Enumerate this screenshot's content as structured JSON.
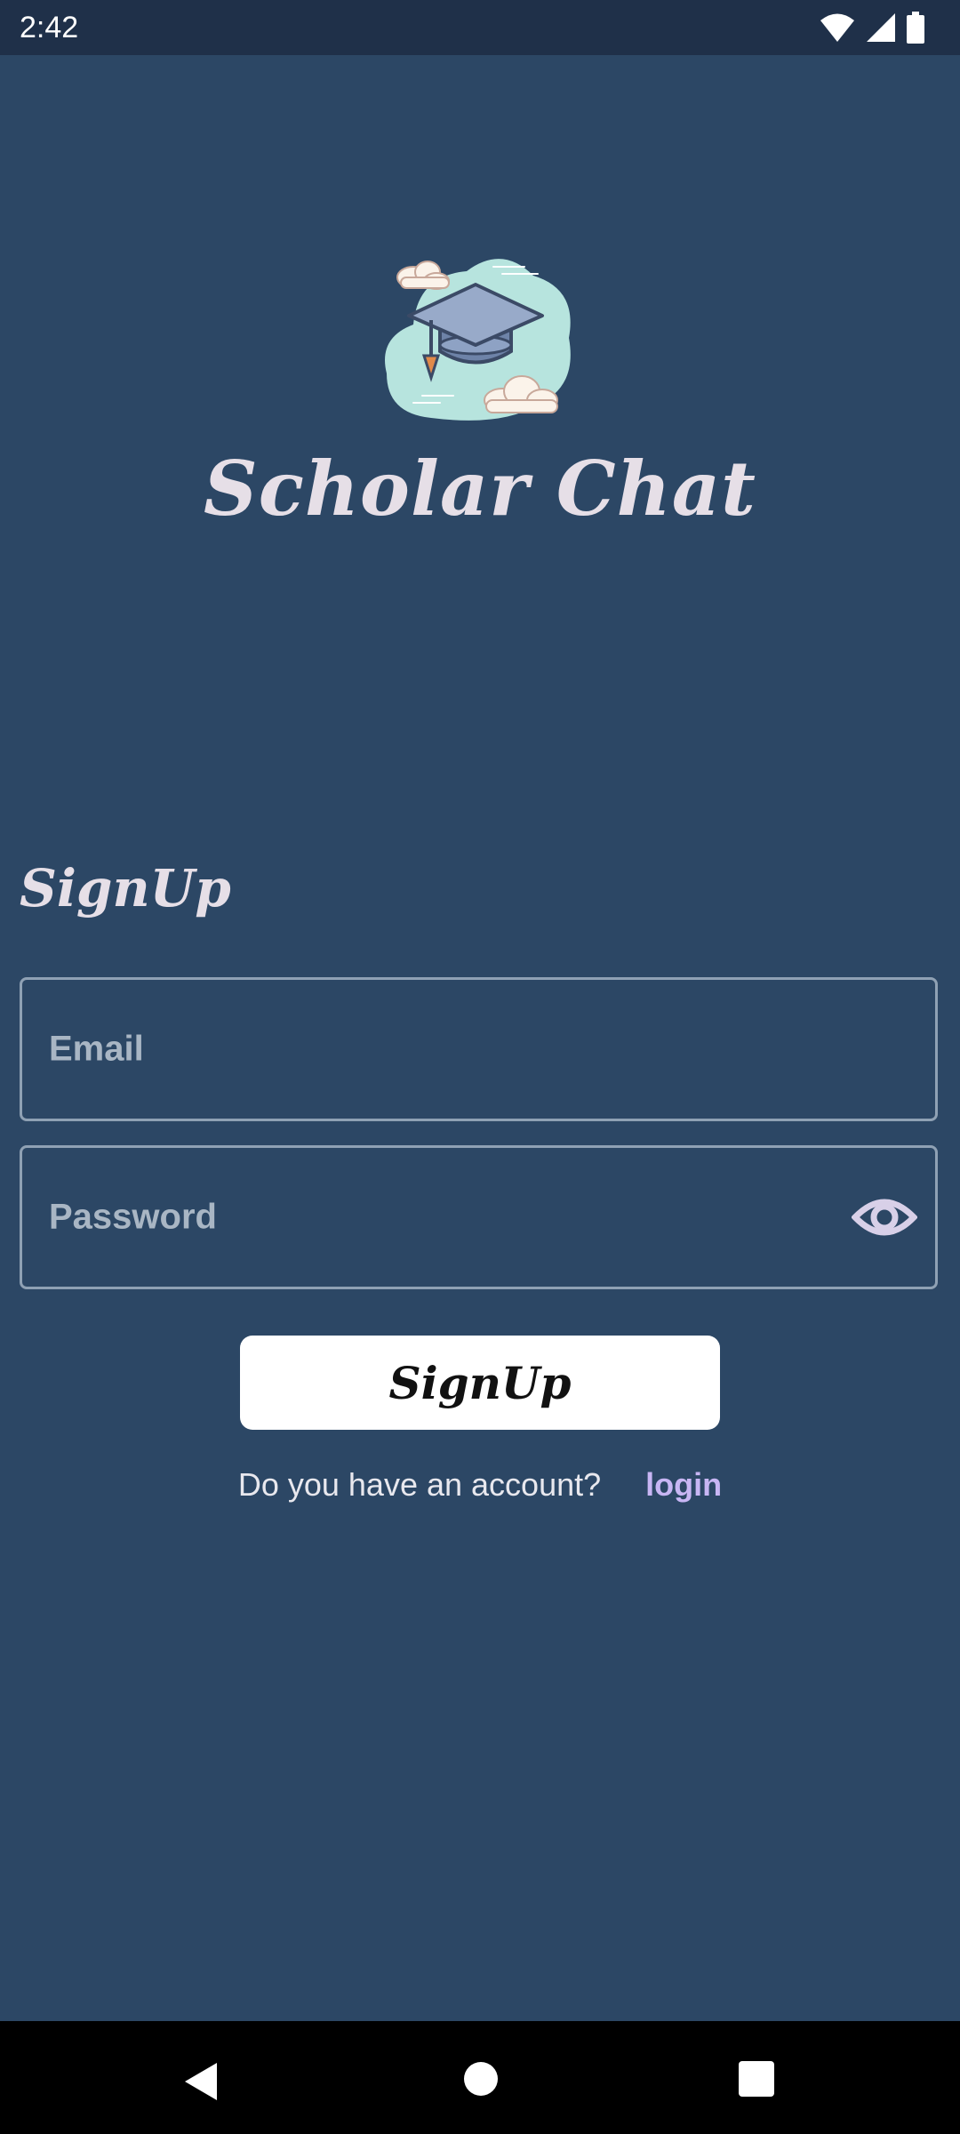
{
  "status_bar": {
    "time": "2:42",
    "icons": [
      "wifi-icon",
      "signal-icon",
      "battery-icon"
    ]
  },
  "app": {
    "title": "Scholar Chat",
    "logo_icon": "graduation-cap-cloud-logo"
  },
  "form": {
    "title": "SignUp",
    "email_placeholder": "Email",
    "password_placeholder": "Password",
    "password_toggle_icon": "eye-icon",
    "submit_label": "SignUp"
  },
  "footer": {
    "question": "Do you have an account?",
    "login_label": "login"
  },
  "colors": {
    "background": "#2c4765",
    "status_bar": "#1f3049",
    "title_text": "#e6dfe7",
    "field_border": "#8fa1b4",
    "placeholder": "#a9b6c4",
    "link": "#c8b6f4",
    "button_bg": "#ffffff"
  },
  "nav_bar": {
    "icons": [
      "back-icon",
      "home-icon",
      "recents-icon"
    ]
  }
}
